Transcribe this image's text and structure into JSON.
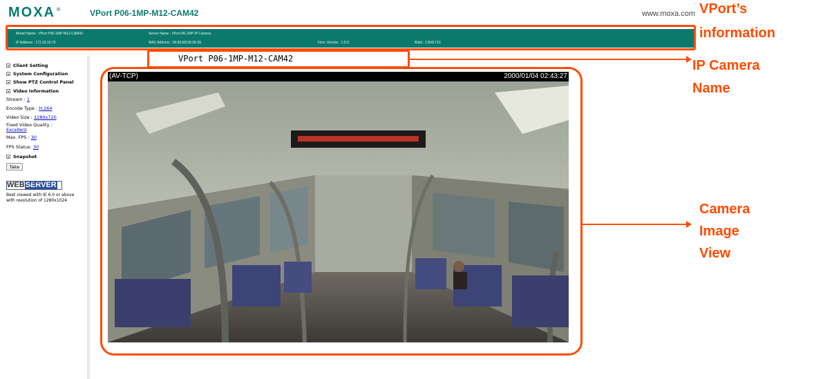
{
  "header": {
    "logo": "MOXA",
    "logo_mark": "®",
    "title": "VPort P06-1MP-M12-CAM42",
    "url": "www.moxa.com"
  },
  "info": {
    "model_name": "Model Name : VPort P06-1MP-M12-CAM42",
    "server_name": "Server Name : VPort 06-1MP IP Camera",
    "ip_address": "IP Address : 172.15.16.70",
    "mac_address": "MAC Address : 00:90:E8:30:2E:05",
    "firm_version": "Firm. Version : 1.0.0",
    "build": "Build : 13041713"
  },
  "sidebar": {
    "client_setting": "Client Setting",
    "system_configuration": "System Configuration",
    "show_ptz": "Show PTZ Control Panel",
    "video_information": "Video Information",
    "stream_label": "Stream : ",
    "stream_value": "1",
    "encode_label": "Encode Type : ",
    "encode_value": "H.264",
    "size_label": "Video Size : ",
    "size_value": "1280x720",
    "quality_label": "Fixed Video Quality :",
    "quality_value": "Excellent",
    "maxfps_label": "Max. FPS : ",
    "maxfps_value": "30",
    "fpsstatus_label": "FPS Status: ",
    "fpsstatus_value": "30",
    "snapshot": "Snapshot",
    "take_button": "Take",
    "webserver_goahead": "goahead",
    "webserver_web": "WEB",
    "webserver_server": "SERVER",
    "best_line1": "Best viewed with IE 6.0 or above",
    "best_line2": "with resolution of 1280x1024"
  },
  "camera": {
    "name": "VPort P06-1MP-M12-CAM42",
    "stream_mode": "(AV-TCP)",
    "timestamp": "2000/01/04 02:43:27"
  },
  "annotations": {
    "vport_info_line1": "VPort’s",
    "vport_info_line2": "information",
    "ip_camera_line1": "IP Camera",
    "ip_camera_line2": "Name",
    "camera_view_line1": "Camera",
    "camera_view_line2": "Image",
    "camera_view_line3": "View"
  },
  "colors": {
    "brand": "#0b7a6d",
    "annotation": "#ff4b00",
    "link": "#0000cc"
  }
}
